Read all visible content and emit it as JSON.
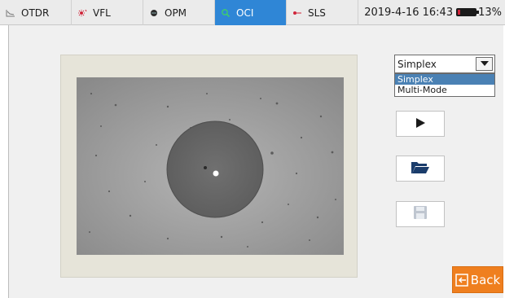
{
  "tabs": [
    {
      "label": "OTDR",
      "icon": "trace-icon",
      "active": false
    },
    {
      "label": "VFL",
      "icon": "laser-icon",
      "active": false
    },
    {
      "label": "OPM",
      "icon": "power-meter-icon",
      "active": false
    },
    {
      "label": "OCI",
      "icon": "microscope-icon",
      "active": true
    },
    {
      "label": "SLS",
      "icon": "light-source-icon",
      "active": false
    }
  ],
  "status": {
    "datetime": "2019-4-16 16:43",
    "battery_percent_label": "13%",
    "battery_level": 0.13,
    "battery_color": "#d0253a"
  },
  "mode_select": {
    "selected": "Simplex",
    "options": [
      "Simplex",
      "Multi-Mode"
    ]
  },
  "buttons": {
    "play": "play-icon",
    "open": "folder-icon",
    "save": "save-icon",
    "back_label": "Back"
  },
  "colors": {
    "accent": "#2f86d6",
    "back_button": "#ef7f1f",
    "selected_option": "#4a81b4"
  }
}
